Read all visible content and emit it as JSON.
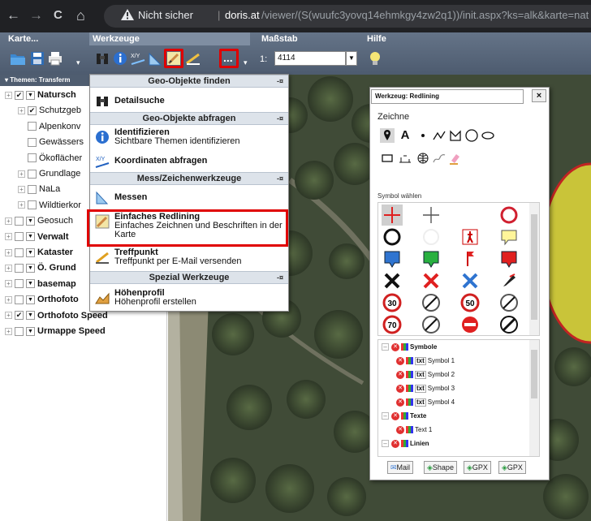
{
  "browser": {
    "back": "←",
    "forward": "→",
    "reload": "C",
    "home": "⌂",
    "not_secure": "Nicht sicher",
    "url_host": "doris.at",
    "url_path": "/viewer/(S(wuufc3yovq14ehmkgy4zw2q1))/init.aspx?ks=alk&karte=nat"
  },
  "ribbon": {
    "groups": [
      "Karte...",
      "Werkzeuge",
      "Maßstab",
      "Hilfe"
    ],
    "scale_prefix": "1:",
    "scale_value": "4114",
    "more_label": "..."
  },
  "tree": {
    "header": "▾ Themen: Transferm",
    "rows": [
      {
        "label": "Natursch",
        "bold": true,
        "checked": true
      },
      {
        "label": "Schutzgeb",
        "bold": false,
        "checked": true
      },
      {
        "label": "Alpenkonv",
        "bold": false,
        "checked": false
      },
      {
        "label": "Gewässers",
        "bold": false,
        "checked": false
      },
      {
        "label": "Ökoflächer",
        "bold": false,
        "checked": false
      },
      {
        "label": "Grundlage",
        "bold": false,
        "checked": false
      },
      {
        "label": "NaLa",
        "bold": false,
        "checked": false
      },
      {
        "label": "Wildtierkor",
        "bold": false,
        "checked": false
      },
      {
        "label": "Geosuch",
        "bold": false,
        "checked": false
      },
      {
        "label": "Verwalt",
        "bold": true,
        "checked": false
      },
      {
        "label": "Kataster",
        "bold": true,
        "checked": false
      },
      {
        "label": "Ö. Grund",
        "bold": true,
        "checked": false
      },
      {
        "label": "basemap",
        "bold": true,
        "checked": false
      },
      {
        "label": "Orthofoto",
        "bold": true,
        "checked": false
      },
      {
        "label": "Orthofoto Speed",
        "bold": true,
        "checked": true
      },
      {
        "label": "Urmappe Speed",
        "bold": true,
        "checked": false
      }
    ]
  },
  "menu": {
    "sec1": "Geo-Objekte finden",
    "detailsuche": "Detailsuche",
    "sec2": "Geo-Objekte abfragen",
    "identifizieren": "Identifizieren",
    "identifizieren_sub": "Sichtbare Themen identifizieren",
    "koordinaten": "Koordinaten abfragen",
    "sec3": "Mess/Zeichenwerkzeuge",
    "messen": "Messen",
    "redlining": "Einfaches Redlining",
    "redlining_sub": "Einfaches Zeichnen und Beschriften in der Karte",
    "treffpunkt": "Treffpunkt",
    "treffpunkt_sub": "Treffpunkt per E-Mail versenden",
    "sec4": "Spezial Werkzeuge",
    "hoehenprofil": "Höhenprofil",
    "hoehenprofil_sub": "Höhenprofil erstellen",
    "pin": "-¤"
  },
  "redlining": {
    "title": "Werkzeug: Redlining",
    "close": "×",
    "zeichne": "Zeichne",
    "tool_text": "A",
    "symbol_label": "Symbol wählen",
    "speed_signs": [
      "30",
      "50",
      "70"
    ],
    "list": [
      {
        "label": "Symbole",
        "level": 0,
        "txt": false
      },
      {
        "label": "Symbol 1",
        "level": 1,
        "txt": true
      },
      {
        "label": "Symbol 2",
        "level": 1,
        "txt": true
      },
      {
        "label": "Symbol 3",
        "level": 1,
        "txt": true
      },
      {
        "label": "Symbol 4",
        "level": 1,
        "txt": true
      },
      {
        "label": "Texte",
        "level": 0,
        "txt": false
      },
      {
        "label": "Text 1",
        "level": 1,
        "txt": false
      },
      {
        "label": "Linien",
        "level": 0,
        "txt": false
      }
    ],
    "txt_tag": "txt",
    "export": [
      "Mail",
      "Shape",
      "GPX",
      "GPX"
    ]
  },
  "colors": {
    "highlight": "#e00000",
    "ribbon": "#5a687c",
    "buffer_yellow": "#d8d23a"
  }
}
